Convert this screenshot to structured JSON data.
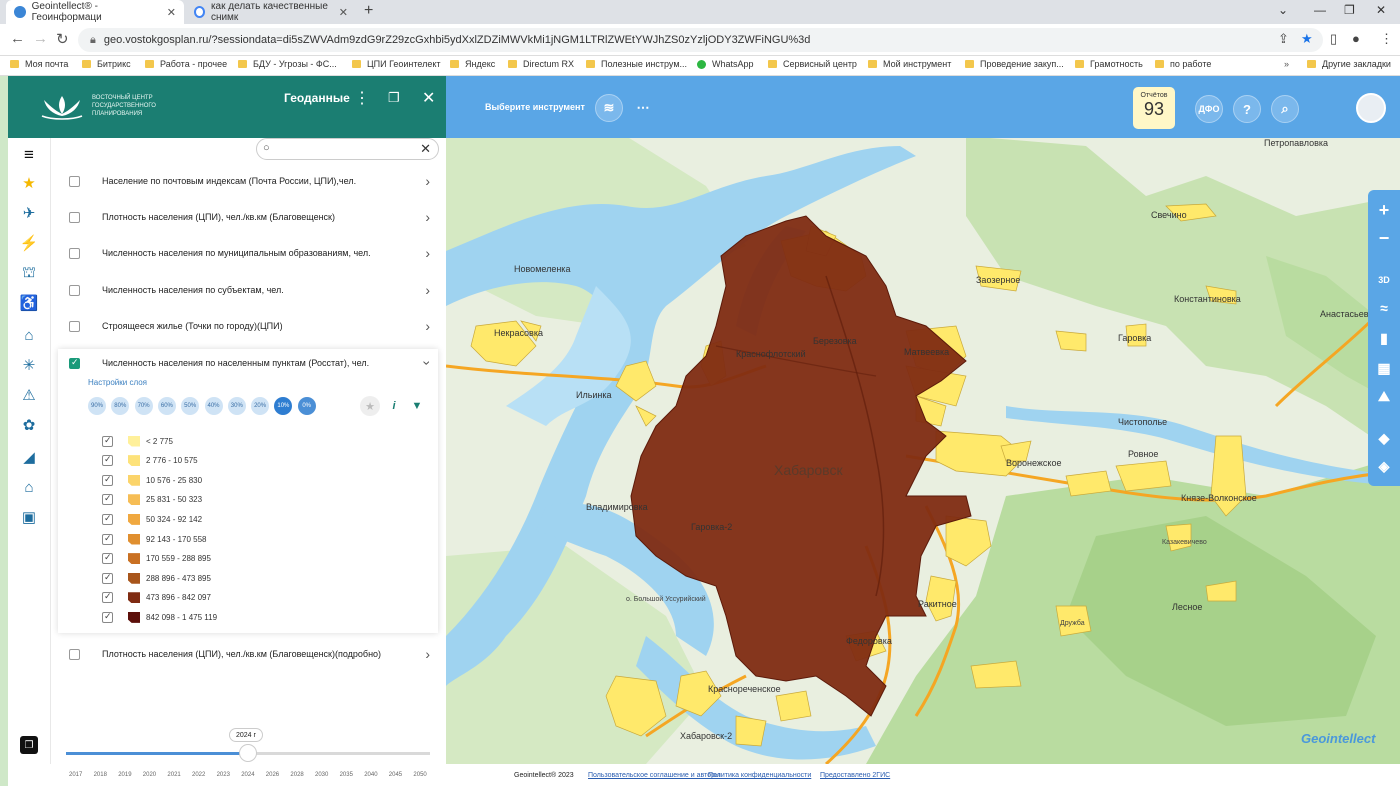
{
  "browser": {
    "tabs": [
      {
        "title": "Geointellect® - Геоинформаци",
        "active": true
      },
      {
        "title": "как делать качественные снимк",
        "active": false
      }
    ],
    "url": "geo.vostokgosplan.ru/?sessiondata=di5sZWVAdm9zdG9rZ29zcGxhbi5ydXxlZDZiMWVkMi1jNGM1LTRlZWEtYWJhZS0zYzljODY3ZWFiNGU%3d",
    "bookmarks": [
      "Моя почта",
      "Битрикс",
      "Работа - прочее",
      "БДУ - Угрозы - ФС...",
      "ЦПИ Геоинтелект",
      "Яндекс",
      "Directum RX",
      "Полезные инструм...",
      "WhatsApp",
      "Сервисный центр",
      "Мой инструмент",
      "Проведение закуп...",
      "Грамотность",
      "по работе"
    ],
    "other_bookmarks": "Другие закладки"
  },
  "header": {
    "logo_text_1": "ВОСТОЧНЫЙ ЦЕНТР",
    "logo_text_2": "ГОСУДАРСТВЕННОГО",
    "logo_text_3": "ПЛАНИРОВАНИЯ",
    "title": "Геоданные"
  },
  "search": {
    "placeholder": ""
  },
  "layers": [
    "Население по почтовым индексам (Почта России, ЦПИ),чел.",
    "Плотность населения (ЦПИ), чел./кв.км (Благовещенск)",
    "Численность населения по муниципальным образованиям, чел.",
    "Численность населения по субъектам, чел.",
    "Строящееся жилье (Точки по городу)(ЦПИ)",
    "Численность населения по населенным пунктам (Росстат), чел.",
    "Плотность населения (ЦПИ), чел./кв.км (Благовещенск)(подробно)"
  ],
  "layer_settings": {
    "title": "Настройки слоя",
    "opacity": [
      "90%",
      "80%",
      "70%",
      "60%",
      "50%",
      "40%",
      "30%",
      "20%",
      "10%",
      "0%"
    ],
    "legend": [
      {
        "label": "< 2 775",
        "color": "#fff09a"
      },
      {
        "label": "2 776 - 10 575",
        "color": "#fde27a"
      },
      {
        "label": "10 576 - 25 830",
        "color": "#fbd46a"
      },
      {
        "label": "25 831 - 50 323",
        "color": "#f6bd55"
      },
      {
        "label": "50 324 - 92 142",
        "color": "#f0a840"
      },
      {
        "label": "92 143 - 170 558",
        "color": "#e08f2f"
      },
      {
        "label": "170 559 - 288 895",
        "color": "#c97022"
      },
      {
        "label": "288 896 - 473 895",
        "color": "#a8551b"
      },
      {
        "label": "473 896 - 842 097",
        "color": "#7f2b12"
      },
      {
        "label": "842 098 - 1 475 119",
        "color": "#5c0f0a"
      }
    ]
  },
  "timeline": {
    "current": "2024 г",
    "years": [
      "2017",
      "2018",
      "2019",
      "2020",
      "2021",
      "2022",
      "2023",
      "2024",
      "2026",
      "2028",
      "2030",
      "2035",
      "2040",
      "2045",
      "2050"
    ],
    "progress": 0.5
  },
  "toolbar": {
    "tool_select": "Выберите инструмент",
    "reports_label": "Отчётов",
    "reports_count": "93",
    "dfo": "ДФО"
  },
  "map_labels": [
    "Петропавловка",
    "Свечино",
    "Новомеленка",
    "Заозерное",
    "Константиновка",
    "Анастасьевское",
    "Гаровка",
    "Некрасовка",
    "Ильинка",
    "Краснофлотский",
    "Березовка",
    "Матвеевка",
    "Чистополье",
    "Ровное",
    "Воронежское",
    "Князе-Волконское",
    "Хабаровск",
    "Владимировка",
    "Гаровка-2",
    "Казакевичево",
    "Дружба",
    "Лесное",
    "Федоровка",
    "о. Большой Уссурийский",
    "Краснореченское",
    "Ракитное",
    "Хабаровск-2"
  ],
  "footer": {
    "copyright": "Geointellect® 2023",
    "agreement": "Пользовательское соглашение и авторы",
    "privacy": "Политика конфиденциальности",
    "provided": "Предоставлено 2ГИС"
  },
  "brand": "Geointellect",
  "colors": {
    "accent": "#5aa6e6",
    "header": "#1b7e72",
    "city": "#7f2b12"
  }
}
